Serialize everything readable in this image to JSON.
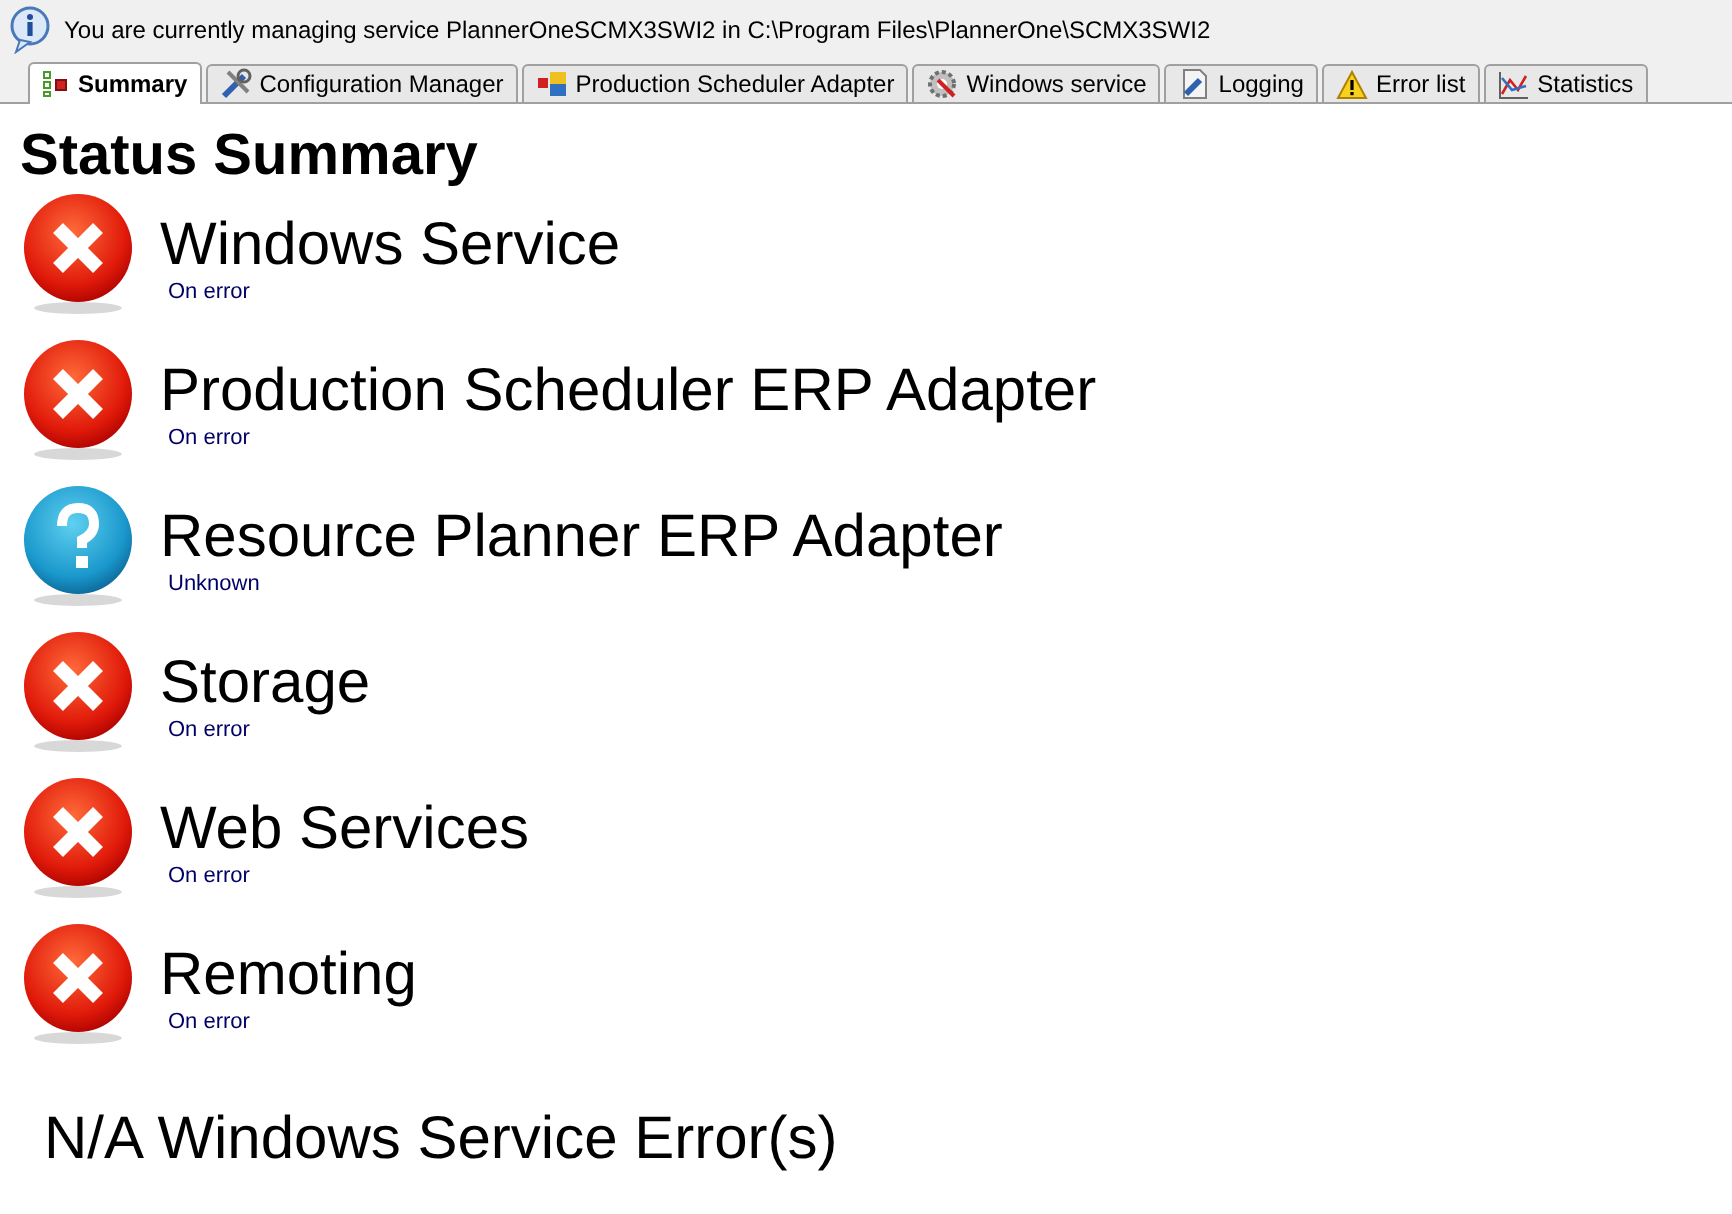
{
  "info_bar": {
    "text": "You are currently managing service PlannerOneSCMX3SWI2 in C:\\Program Files\\PlannerOne\\SCMX3SWI2"
  },
  "tabs": [
    {
      "label": "Summary",
      "selected": true,
      "kind": "summary"
    },
    {
      "label": "Configuration Manager",
      "selected": false,
      "kind": "tools"
    },
    {
      "label": "Production Scheduler Adapter",
      "selected": false,
      "kind": "adapter"
    },
    {
      "label": "Windows service",
      "selected": false,
      "kind": "service"
    },
    {
      "label": "Logging",
      "selected": false,
      "kind": "logging"
    },
    {
      "label": "Error list",
      "selected": false,
      "kind": "warning"
    },
    {
      "label": "Statistics",
      "selected": false,
      "kind": "chart"
    }
  ],
  "heading": "Status Summary",
  "statuses": [
    {
      "name": "Windows Service",
      "status": "On error",
      "kind": "error"
    },
    {
      "name": "Production Scheduler ERP Adapter",
      "status": "On error",
      "kind": "error"
    },
    {
      "name": "Resource Planner ERP Adapter",
      "status": "Unknown",
      "kind": "unknown"
    },
    {
      "name": "Storage",
      "status": "On error",
      "kind": "error"
    },
    {
      "name": "Web Services",
      "status": "On error",
      "kind": "error"
    },
    {
      "name": "Remoting",
      "status": "On error",
      "kind": "error"
    }
  ],
  "footer": "N/A Windows Service Error(s)"
}
